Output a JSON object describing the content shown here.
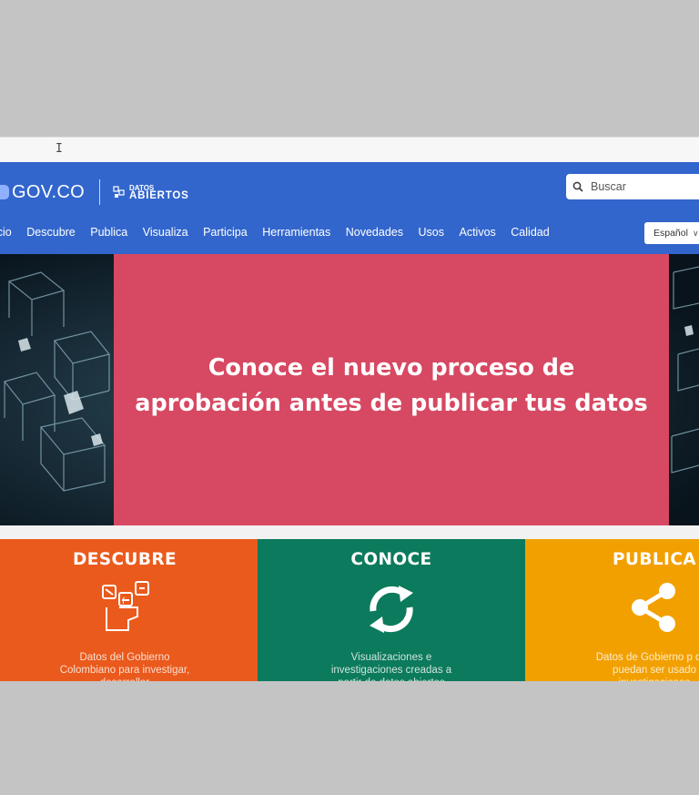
{
  "header": {
    "gov_logo": "GOV.CO",
    "datos_small": "DATOS",
    "datos_big": "ABIERTOS",
    "search_placeholder": "Buscar",
    "language": "Español"
  },
  "nav": [
    "icio",
    "Descubre",
    "Publica",
    "Visualiza",
    "Participa",
    "Herramientas",
    "Novedades",
    "Usos",
    "Activos",
    "Calidad"
  ],
  "hero": {
    "line1": "Conoce el nuevo proceso de",
    "line2": "aprobación antes de publicar tus datos",
    "panel_color": "#d74862"
  },
  "cards": [
    {
      "title": "DESCUBRE",
      "icon": "data-discovery-icon",
      "text": "Datos del Gobierno Colombiano para investigar, desarrollar",
      "color": "#ea5a1c"
    },
    {
      "title": "CONOCE",
      "icon": "refresh-cycle-icon",
      "text": "Visualizaciones e investigaciones creadas a partir de datos abiertos",
      "color": "#0c7a5c"
    },
    {
      "title": "PUBLICA",
      "icon": "share-icon",
      "text": "Datos de Gobierno p que puedan ser usado investigaciones",
      "color": "#f2a000"
    }
  ],
  "colors": {
    "header_blue": "#3366cc"
  }
}
